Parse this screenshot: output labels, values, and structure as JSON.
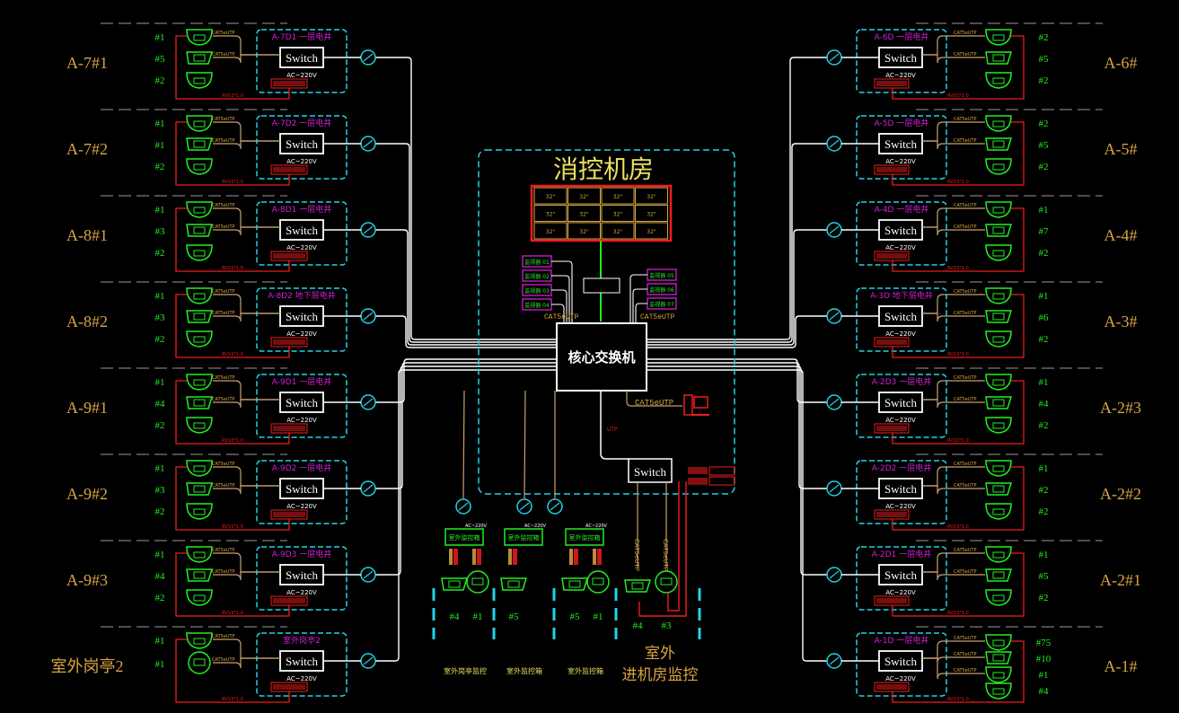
{
  "colors": {
    "background": "#000000",
    "white": "#ffffff",
    "cyan": "#22d3e6",
    "green": "#22ee22",
    "red": "#ee1c1c",
    "orange": "#d9a441",
    "tan": "#c8a070",
    "magenta": "#d020d0",
    "yellow": "#e8e060",
    "gray": "#9a9a9a"
  },
  "control_room": {
    "title": "消控机房",
    "core_switch_label": "核心交换机",
    "cable_left": "CAT5eUTP",
    "cable_right": "CAT5eUTP",
    "cable_pc": "CAT5eUTP",
    "sub_switch_label": "Switch",
    "video_wall_rows": 3,
    "video_wall_cols": 4,
    "left_panels": [
      "监视器 01",
      "监视器 02",
      "监视器 03",
      "监视器 04"
    ],
    "right_panels": [
      "监视器 05",
      "监视器 06",
      "监视器 07"
    ]
  },
  "left_stations": [
    {
      "label": "A-7#1",
      "box_title": "A-7D1 一层电井",
      "switch": "Switch",
      "power": "AC~220V",
      "cams": [
        "#1",
        "#5",
        "#2"
      ]
    },
    {
      "label": "A-7#2",
      "box_title": "A-7D2 一层电井",
      "switch": "Switch",
      "power": "AC~220V",
      "cams": [
        "#1",
        "#1",
        "#2"
      ]
    },
    {
      "label": "A-8#1",
      "box_title": "A-8D1 一层电井",
      "switch": "Switch",
      "power": "AC~220V",
      "cams": [
        "#1",
        "#3",
        "#2"
      ]
    },
    {
      "label": "A-8#2",
      "box_title": "A-8D2 地下层电井",
      "switch": "Switch",
      "power": "AC~220V",
      "cams": [
        "#1",
        "#3",
        "#2"
      ]
    },
    {
      "label": "A-9#1",
      "box_title": "A-9D1 一层电井",
      "switch": "Switch",
      "power": "AC~220V",
      "cams": [
        "#1",
        "#4",
        "#2"
      ]
    },
    {
      "label": "A-9#2",
      "box_title": "A-9D2 一层电井",
      "switch": "Switch",
      "power": "AC~220V",
      "cams": [
        "#1",
        "#3",
        "#2"
      ]
    },
    {
      "label": "A-9#3",
      "box_title": "A-9D3 一层电井",
      "switch": "Switch",
      "power": "AC~220V",
      "cams": [
        "#1",
        "#4",
        "#2"
      ]
    },
    {
      "label": "室外岗亭2",
      "box_title": "室外岗亭2",
      "switch": "Switch",
      "power": "AC~220V",
      "cams": [
        "#1",
        "#1"
      ]
    }
  ],
  "right_stations": [
    {
      "label": "A-6#",
      "box_title": "A-6D 一层电井",
      "switch": "Switch",
      "power": "AC~220V",
      "cams": [
        "#2",
        "#5",
        "#2"
      ]
    },
    {
      "label": "A-5#",
      "box_title": "A-5D 一层电井",
      "switch": "Switch",
      "power": "AC~220V",
      "cams": [
        "#2",
        "#5",
        "#2"
      ]
    },
    {
      "label": "A-4#",
      "box_title": "A-4D 一层电井",
      "switch": "Switch",
      "power": "AC~220V",
      "cams": [
        "#1",
        "#7",
        "#2"
      ]
    },
    {
      "label": "A-3#",
      "box_title": "A-3D 地下层电井",
      "switch": "Switch",
      "power": "AC~220V",
      "cams": [
        "#1",
        "#6",
        "#2"
      ]
    },
    {
      "label": "A-2#3",
      "box_title": "A-2D3 一层电井",
      "switch": "Switch",
      "power": "AC~220V",
      "cams": [
        "#1",
        "#4",
        "#2"
      ]
    },
    {
      "label": "A-2#2",
      "box_title": "A-2D2 一层电井",
      "switch": "Switch",
      "power": "AC~220V",
      "cams": [
        "#1",
        "#2",
        "#2"
      ]
    },
    {
      "label": "A-2#1",
      "box_title": "A-2D1 一层电井",
      "switch": "Switch",
      "power": "AC~220V",
      "cams": [
        "#1",
        "#5",
        "#2"
      ]
    },
    {
      "label": "A-1#",
      "box_title": "A-1D 一层电井",
      "switch": "Switch",
      "power": "AC~220V",
      "cams": [
        "#75",
        "#10",
        "#1",
        "#4"
      ]
    }
  ],
  "bottom_groups": [
    {
      "box": "室外监控箱",
      "power": "AC~220V",
      "cams": [
        "#4",
        "#1"
      ],
      "caption": "室外岗亭监控"
    },
    {
      "box": "室外监控箱",
      "power": "AC~220V",
      "cams": [
        "#5"
      ],
      "caption": "室外监控箱"
    },
    {
      "box": "室外监控箱",
      "power": "AC~220V",
      "cams": [
        "#5",
        "#1"
      ],
      "caption": "室外监控箱"
    },
    {
      "box": "",
      "power": "",
      "cams": [
        "#4",
        "#3"
      ],
      "caption": "室外\n进机房监控"
    }
  ],
  "bottom_caption_outdoor": "室外",
  "bottom_caption_entry": "进机房监控"
}
